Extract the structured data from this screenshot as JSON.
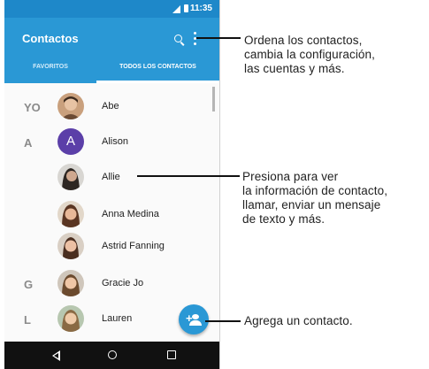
{
  "status": {
    "time": "11:35"
  },
  "appbar": {
    "title": "Contactos",
    "search_icon": "search-icon",
    "more_icon": "more-vert-icon"
  },
  "tabs": [
    {
      "label": "FAVORITOS"
    },
    {
      "label": "TODOS LOS CONTACTOS"
    }
  ],
  "contacts": [
    {
      "section": "YO",
      "name": "Abe",
      "avatar_text": ""
    },
    {
      "section": "A",
      "name": "Alison",
      "avatar_text": "A"
    },
    {
      "section": "",
      "name": "Allie",
      "avatar_text": ""
    },
    {
      "section": "",
      "name": "Anna Medina",
      "avatar_text": ""
    },
    {
      "section": "",
      "name": "Astrid Fanning",
      "avatar_text": ""
    },
    {
      "section": "G",
      "name": "Gracie Jo",
      "avatar_text": ""
    },
    {
      "section": "L",
      "name": "Lauren",
      "avatar_text": ""
    }
  ],
  "fab": {
    "icon": "add-contact-icon"
  },
  "callouts": {
    "menu": [
      "Ordena los contactos,",
      "cambia la configuración,",
      "las cuentas y más."
    ],
    "contact": [
      "Presiona para ver",
      "la información de contacto,",
      "llamar, enviar un mensaje",
      "de texto y más."
    ],
    "add": [
      "Agrega un contacto."
    ]
  },
  "colors": {
    "accent": "#2a98d5",
    "alison_avatar": "#5b3fa8"
  }
}
